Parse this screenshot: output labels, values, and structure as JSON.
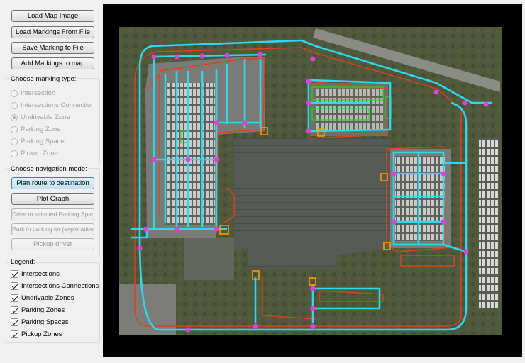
{
  "toolbar": {
    "load_map_label": "Load Map Image",
    "load_markings_label": "Load Markings From File",
    "save_marking_label": "Save Marking to File",
    "add_markings_label": "Add Markings to map"
  },
  "marking_type": {
    "title": "Choose marking type:",
    "options": [
      {
        "label": "Intersection",
        "selected": false
      },
      {
        "label": "Intersections Connection",
        "selected": false
      },
      {
        "label": "Undrivable Zone",
        "selected": true
      },
      {
        "label": "Parking Zone",
        "selected": false
      },
      {
        "label": "Parking Space",
        "selected": false
      },
      {
        "label": "Pickup Zone",
        "selected": false
      }
    ]
  },
  "navigation_mode": {
    "title": "Choose navigation mode:",
    "plan_route_label": "Plan route to destination",
    "plot_graph_label": "Plot Graph",
    "drive_to_space_label": "Drive to selected Parking Space",
    "park_exploration_label": "Park in parking lot (exploration)",
    "pickup_driver_label": "Pickup driver"
  },
  "legend": {
    "title": "Legend:",
    "items": [
      {
        "label": "Intersections",
        "checked": true
      },
      {
        "label": "Intersections Connections",
        "checked": true
      },
      {
        "label": "Undrivable Zones",
        "checked": true
      },
      {
        "label": "Parking Zones",
        "checked": true
      },
      {
        "label": "Parking Spaces",
        "checked": true
      },
      {
        "label": "Pickup Zones",
        "checked": true
      }
    ]
  },
  "map": {
    "road_color": "#2fd7f0",
    "intersection_color": "#e040e0",
    "undrivable_color": "#e0401c",
    "parking_space_color": "#2fcf2f",
    "pickup_color": "#ff9a00",
    "background_color": "#000000"
  }
}
